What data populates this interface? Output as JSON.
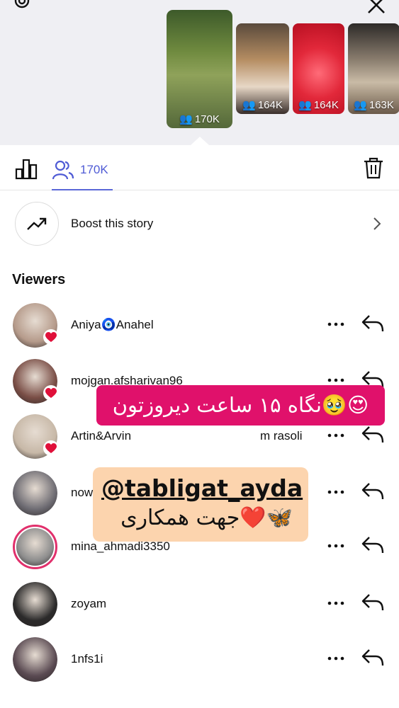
{
  "header": {
    "thumbnails": [
      {
        "count": "170K"
      },
      {
        "count": "164K"
      },
      {
        "count": "164K"
      },
      {
        "count": "163K"
      }
    ]
  },
  "tabs": {
    "viewers_count": "170K"
  },
  "boost": {
    "label": "Boost this story"
  },
  "viewers": {
    "title": "Viewers",
    "items": [
      {
        "name": "Aniya🧿Anahel",
        "liked": true,
        "avatar": "#b59a8a"
      },
      {
        "name": "mojgan.afsharivan96",
        "liked": true,
        "avatar": "#7a4e46"
      },
      {
        "name": "Artin&Arvin",
        "sub": "m rasoli",
        "liked": true,
        "avatar": "#c7b8a7"
      },
      {
        "name": "now",
        "liked": false,
        "avatar": "#6d6b72"
      },
      {
        "name": "mina_ahmadi3350",
        "liked": false,
        "avatar": "#8d8d8d"
      },
      {
        "name": "zoyam",
        "liked": false,
        "avatar": "#2b2a2a"
      },
      {
        "name": "1nfs1i",
        "liked": false,
        "avatar": "#5a4a52"
      }
    ]
  },
  "stickers": {
    "pink_text": "نگاه ۱۵ ساعت دیروزتون🥹😍",
    "handle": "@tabligat_ayda",
    "sub_text": "جهت همکاری❤️🦋"
  },
  "colors": {
    "accent": "#4f5bd5",
    "heart": "#e0103a",
    "pink_sticker": "#e0116b",
    "peach_sticker": "#fcd4ae"
  }
}
